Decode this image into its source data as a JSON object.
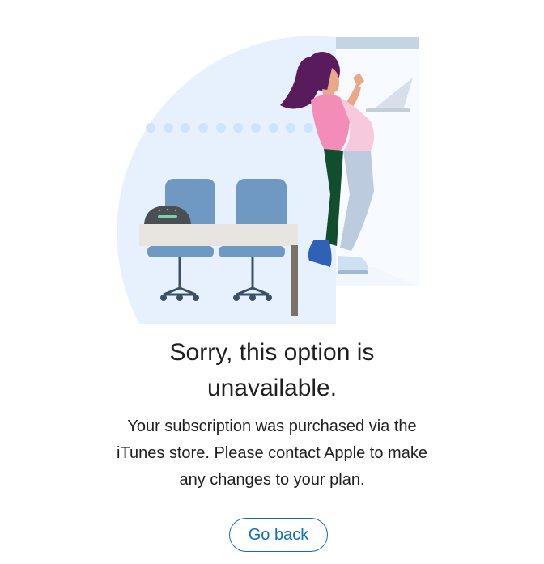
{
  "illustration": {
    "icon": "person-leaving-office-illustration"
  },
  "dialog": {
    "title_line1": "Sorry, this option is",
    "title_line2": "unavailable.",
    "message_line1": "Your subscription was purchased via the",
    "message_line2": "iTunes store. Please contact Apple to make",
    "message_line3": "any changes to your plan.",
    "go_back_label": "Go back"
  },
  "colors": {
    "accent": "#0f6cbd",
    "text": "#1f1f1f",
    "background": "#ffffff"
  }
}
